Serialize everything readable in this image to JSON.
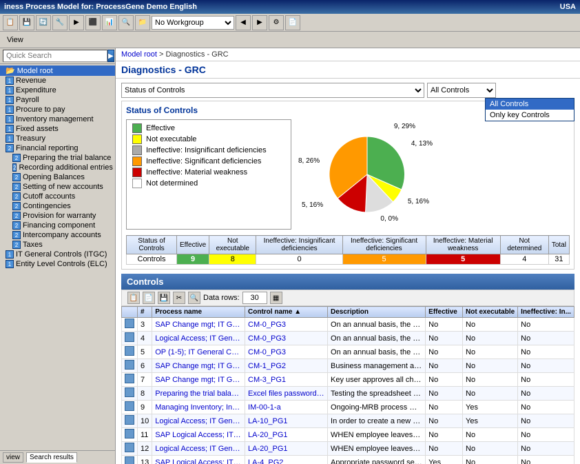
{
  "titleBar": {
    "title": "iness Process Model for: ProcessGene Demo English",
    "region": "USA"
  },
  "toolbar": {
    "workgroup": "No Workgroup"
  },
  "menuItems": [
    "View"
  ],
  "sidebar": {
    "searchPlaceholder": "Quick Search",
    "items": [
      {
        "label": "Model root",
        "level": 1,
        "selected": true,
        "hasIcon": false
      },
      {
        "label": "Revenue",
        "level": 1,
        "selected": false,
        "hasIcon": true
      },
      {
        "label": "Expenditure",
        "level": 1,
        "selected": false,
        "hasIcon": true
      },
      {
        "label": "Payroll",
        "level": 1,
        "selected": false,
        "hasIcon": true
      },
      {
        "label": "Procure to pay",
        "level": 1,
        "selected": false,
        "hasIcon": true
      },
      {
        "label": "Inventory management",
        "level": 1,
        "selected": false,
        "hasIcon": true
      },
      {
        "label": "Fixed assets",
        "level": 1,
        "selected": false,
        "hasIcon": true
      },
      {
        "label": "Treasury",
        "level": 1,
        "selected": false,
        "hasIcon": true
      },
      {
        "label": "Financial reporting",
        "level": 1,
        "selected": false,
        "hasIcon": true
      },
      {
        "label": "Preparing the trial balance",
        "level": 2,
        "selected": false,
        "hasIcon": true
      },
      {
        "label": "Recording additional entries",
        "level": 2,
        "selected": false,
        "hasIcon": true
      },
      {
        "label": "Opening Balances",
        "level": 2,
        "selected": false,
        "hasIcon": true
      },
      {
        "label": "Setting of new accounts",
        "level": 2,
        "selected": false,
        "hasIcon": true
      },
      {
        "label": "Cutoff accounts",
        "level": 2,
        "selected": false,
        "hasIcon": true
      },
      {
        "label": "Contingencies",
        "level": 2,
        "selected": false,
        "hasIcon": true
      },
      {
        "label": "Provision for warranty",
        "level": 2,
        "selected": false,
        "hasIcon": true
      },
      {
        "label": "Financing component",
        "level": 2,
        "selected": false,
        "hasIcon": true
      },
      {
        "label": "Intercompany accounts",
        "level": 2,
        "selected": false,
        "hasIcon": true
      },
      {
        "label": "Taxes",
        "level": 2,
        "selected": false,
        "hasIcon": true
      },
      {
        "label": "IT General Controls (ITGC)",
        "level": 1,
        "selected": false,
        "hasIcon": true
      },
      {
        "label": "Entity Level Controls (ELC)",
        "level": 1,
        "selected": false,
        "hasIcon": true
      }
    ],
    "tabs": [
      {
        "label": "view",
        "active": false
      },
      {
        "label": "Search results",
        "active": true
      }
    ],
    "bottomLabel": "Search"
  },
  "breadcrumb": {
    "root": "Model root",
    "separator": " > ",
    "child": "Diagnostics - GRC"
  },
  "pageTitle": "Diagnostics - GRC",
  "statusOfControls": {
    "dropdownLabel": "Status of Controls",
    "controlsDropdown": "All Controls",
    "controlsOptions": [
      "All Controls",
      "Only key Controls"
    ],
    "sectionTitle": "Status of Controls",
    "legend": [
      {
        "color": "#4caf50",
        "label": "Effective"
      },
      {
        "color": "#ffff00",
        "label": "Not executable"
      },
      {
        "color": "#aaaaaa",
        "label": "Ineffective: Insignificant deficiencies"
      },
      {
        "color": "#ff9900",
        "label": "Ineffective: Significant deficiencies"
      },
      {
        "color": "#cc0000",
        "label": "Ineffective: Material weakness"
      },
      {
        "color": "#ffffff",
        "label": "Not determined"
      }
    ],
    "pieSlices": [
      {
        "label": "9, 29%",
        "color": "#4caf50",
        "startAngle": 0,
        "endAngle": 104
      },
      {
        "label": "4, 13%",
        "color": "#ffff00",
        "startAngle": 104,
        "endAngle": 151
      },
      {
        "label": "5, 16%",
        "color": "#aaaaaa",
        "startAngle": 151,
        "endAngle": 209
      },
      {
        "label": "5, 16%",
        "color": "#cc0000",
        "startAngle": 209,
        "endAngle": 267
      },
      {
        "label": "0, 0%",
        "color": "#ff9900",
        "startAngle": 267,
        "endAngle": 267
      },
      {
        "label": "8, 26%",
        "color": "#ff9900",
        "startAngle": 267,
        "endAngle": 360
      }
    ],
    "tableHeaders": [
      "Status of Controls",
      "Effective",
      "Not executable",
      "Ineffective: Insignificant deficiencies",
      "Ineffective: Significant deficiencies",
      "Ineffective: Material weakness",
      "Not determined",
      "Total"
    ],
    "tableRow": {
      "label": "Controls",
      "effective": "9",
      "notExecutable": "8",
      "insignificant": "0",
      "significant": "5",
      "material": "5",
      "notDetermined": "4",
      "total": "31"
    }
  },
  "controlsSection": {
    "title": "Controls",
    "toolbar": {
      "dataRowsLabel": "Data rows:",
      "dataRowsValue": "30"
    },
    "tableHeaders": [
      "#",
      "Process name",
      "Control name ▲",
      "Description",
      "Effective",
      "Not executable",
      "Ineffective: In..."
    ],
    "rows": [
      {
        "num": "3",
        "process": "SAP Change mgt; IT Genera...",
        "control": "CM-0_PG3",
        "description": "On an annual basis, the IT man...",
        "effective": "No",
        "notExecutable": "No",
        "ineffective": "No"
      },
      {
        "num": "4",
        "process": "Logical Access; IT General ...",
        "control": "CM-0_PG3",
        "description": "On an annual basis, the IT man...",
        "effective": "No",
        "notExecutable": "No",
        "ineffective": "No"
      },
      {
        "num": "5",
        "process": "OP (1-5); IT General Contro...",
        "control": "CM-0_PG3",
        "description": "On an annual basis, the IT man...",
        "effective": "No",
        "notExecutable": "No",
        "ineffective": "No"
      },
      {
        "num": "6",
        "process": "SAP Change mgt; IT Genera...",
        "control": "CM-1_PG2",
        "description": "Business management authori...",
        "effective": "No",
        "notExecutable": "No",
        "ineffective": "No"
      },
      {
        "num": "7",
        "process": "SAP Change mgt; IT Genera...",
        "control": "CM-3_PG1",
        "description": "Key user approves all change...",
        "effective": "No",
        "notExecutable": "No",
        "ineffective": "No"
      },
      {
        "num": "8",
        "process": "Preparing the trial balance;...",
        "control": "Excel files password ...",
        "description": "Testing the spreadsheet protect...",
        "effective": "No",
        "notExecutable": "No",
        "ineffective": "No"
      },
      {
        "num": "9",
        "process": "Managing Inventory; Invent...",
        "control": "IM-00-1-a",
        "description": "Ongoing-MRB process manag...",
        "effective": "No",
        "notExecutable": "Yes",
        "ineffective": "No"
      },
      {
        "num": "10",
        "process": "Logical Access; IT General ...",
        "control": "LA-10_PG1",
        "description": "In order to create a new user i...",
        "effective": "No",
        "notExecutable": "Yes",
        "ineffective": "No"
      },
      {
        "num": "11",
        "process": "SAP Logical Access; IT Gene...",
        "control": "LA-20_PG1",
        "description": "WHEN employee leaves the co...",
        "effective": "No",
        "notExecutable": "No",
        "ineffective": "No"
      },
      {
        "num": "12",
        "process": "Logical Access; IT General ...",
        "control": "LA-20_PG1",
        "description": "WHEN employee leaves the co...",
        "effective": "No",
        "notExecutable": "No",
        "ineffective": "No"
      },
      {
        "num": "13",
        "process": "SAP Logical Access; IT Gene...",
        "control": "LA-4_PG2",
        "description": "Appropriate password setting...",
        "effective": "Yes",
        "notExecutable": "No",
        "ineffective": "No"
      }
    ]
  }
}
